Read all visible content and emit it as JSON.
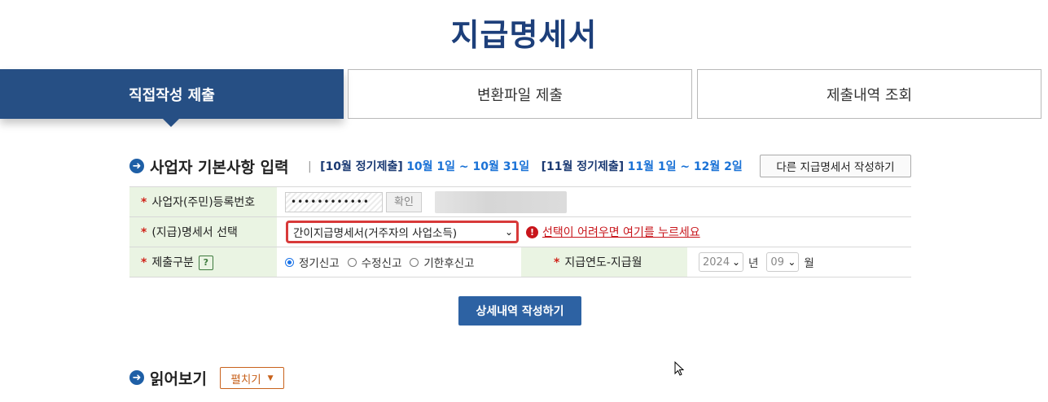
{
  "page": {
    "title": "지급명세서"
  },
  "tabs": [
    {
      "label": "직접작성 제출",
      "active": true
    },
    {
      "label": "변환파일 제출",
      "active": false
    },
    {
      "label": "제출내역 조회",
      "active": false
    }
  ],
  "section1": {
    "title": "사업자 기본사항 입력",
    "period1_label": "[10월 정기제출]",
    "period1_dates": "10월 1일 ~ 10월 31일",
    "period2_label": "[11월 정기제출]",
    "period2_dates": "11월 1일 ~ 12월 2일",
    "other_button": "다른 지급명세서 작성하기"
  },
  "form": {
    "reg_label": "사업자(주민)등록번호",
    "reg_value": "••••••••••••",
    "confirm_button": "확인",
    "doc_label": "(지급)명세서 선택",
    "doc_value": "간이지급명세서(거주자의 사업소득)",
    "doc_help_link": "선택이 어려우면 여기를 누르세요",
    "type_label": "제출구분",
    "help_mark": "?",
    "radio_options": [
      "정기신고",
      "수정신고",
      "기한후신고"
    ],
    "radio_selected": "정기신고",
    "period_label": "지급연도-지급월",
    "year_value": "2024",
    "year_unit": "년",
    "month_value": "09",
    "month_unit": "월"
  },
  "submit_button": "상세내역 작성하기",
  "section2": {
    "title": "읽어보기",
    "expand_button": "펼치기"
  },
  "colors": {
    "primary": "#264f84",
    "accent_blue": "#1a72d6",
    "warning": "#c8151b",
    "row_header_bg": "#eaf4e3"
  }
}
